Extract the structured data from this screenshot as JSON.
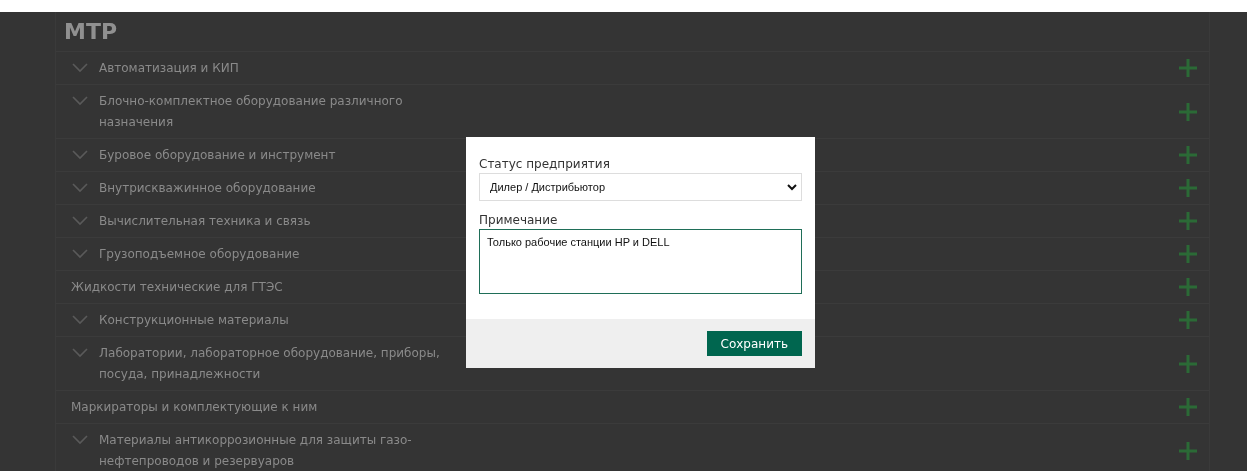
{
  "section": {
    "title": "МТР"
  },
  "categories": [
    {
      "kind": "expandable",
      "label": "Автоматизация и КИП"
    },
    {
      "kind": "expandable",
      "label": "Блочно-комплектное оборудование различного назначения"
    },
    {
      "kind": "expandable",
      "label": "Буровое оборудование и инструмент"
    },
    {
      "kind": "expandable",
      "label": "Внутрискважинное оборудование"
    },
    {
      "kind": "expandable",
      "label": "Вычислительная техника и связь"
    },
    {
      "kind": "expandable",
      "label": "Грузоподъемное оборудование"
    },
    {
      "kind": "plain",
      "label": "Жидкости технические для ГТЭС"
    },
    {
      "kind": "expandable",
      "label": "Конструкционные материалы"
    },
    {
      "kind": "expandable",
      "label": "Лаборатории, лабораторное оборудование, приборы, посуда, принадлежности"
    },
    {
      "kind": "plain",
      "label": "Маркираторы и комплектующие к ним"
    },
    {
      "kind": "expandable",
      "label": "Материалы антикоррозионные для защиты газо-нефтепроводов и резервуаров"
    }
  ],
  "dialog": {
    "status_label": "Статус предприятия",
    "status_value": "Дилер / Дистрибьютор",
    "note_label": "Примечание",
    "note_value": "Только рабочие станции HP и DELL",
    "save_button": "Сохранить"
  }
}
